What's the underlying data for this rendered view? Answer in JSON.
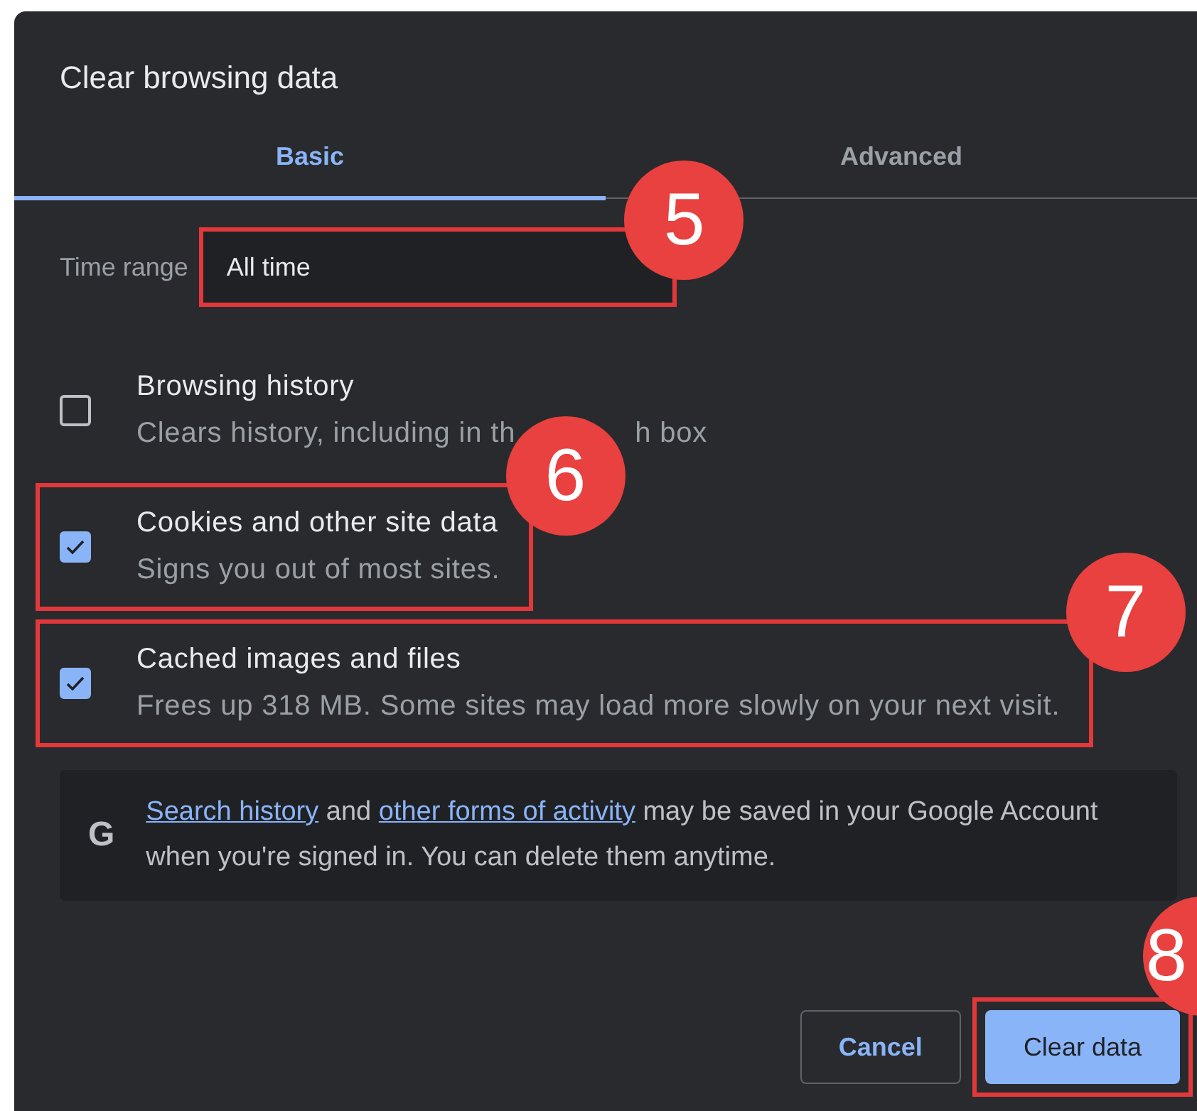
{
  "dialog": {
    "title": "Clear browsing data",
    "tabs": [
      {
        "label": "Basic",
        "selected": true
      },
      {
        "label": "Advanced",
        "selected": false
      }
    ],
    "time_range": {
      "label": "Time range",
      "value": "All time",
      "annotation": "5"
    },
    "options": [
      {
        "title": "Browsing history",
        "description": [
          "Clears history, including in th",
          "h box"
        ],
        "checked": false
      },
      {
        "title": "Cookies and other site data",
        "description": [
          "Signs you out of most sites."
        ],
        "checked": true,
        "annotation": "6"
      },
      {
        "title": "Cached images and files",
        "description": [
          "Frees up 318 MB. Some sites may load more slowly on your next visit."
        ],
        "checked": true,
        "annotation": "7"
      }
    ],
    "info": {
      "icon": "G",
      "segments": [
        {
          "text": "Search history",
          "link": true
        },
        {
          "text": "and",
          "link": false
        },
        {
          "text": "other forms of activity",
          "link": true
        },
        {
          "text": "may be saved in your Google Account when you're signed in. You can delete them anytime.",
          "link": false
        }
      ]
    },
    "buttons": [
      {
        "label": "Cancel",
        "kind": "secondary"
      },
      {
        "label": "Clear data",
        "kind": "primary",
        "annotation": "8"
      }
    ]
  }
}
